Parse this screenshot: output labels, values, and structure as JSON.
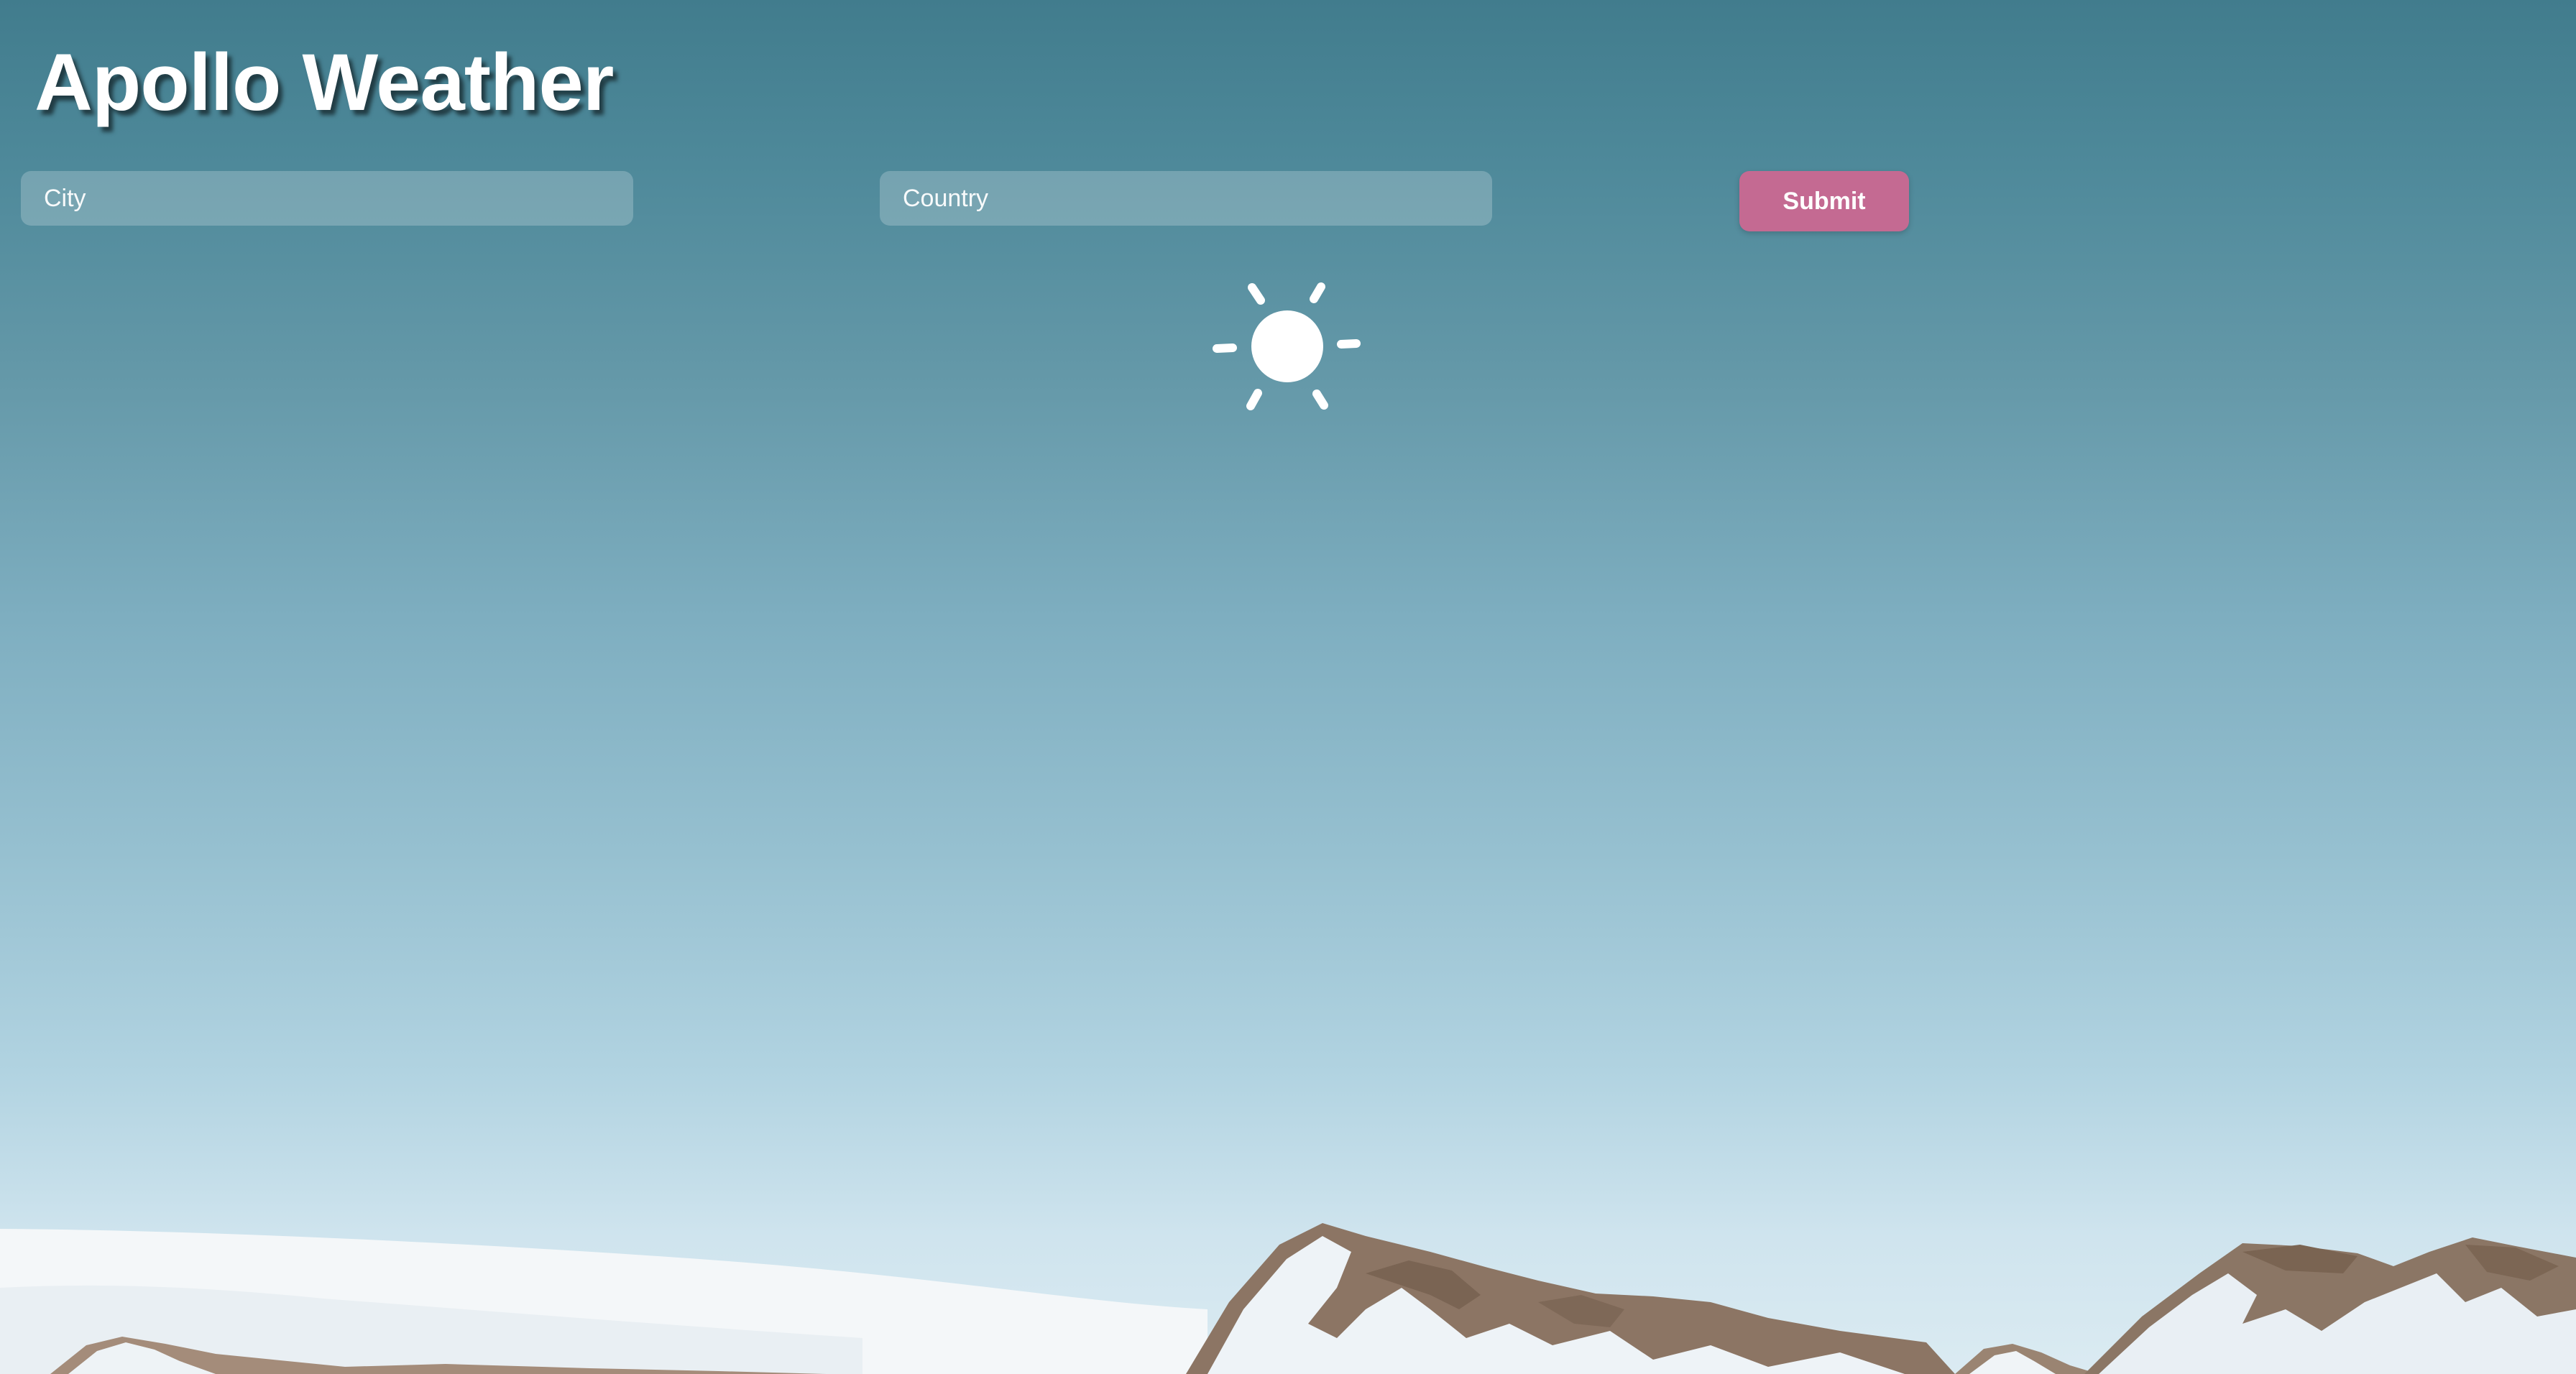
{
  "header": {
    "title": "Apollo Weather"
  },
  "form": {
    "city_placeholder": "City",
    "country_placeholder": "Country",
    "submit_label": "Submit"
  },
  "weather": {
    "icon": "sun-icon"
  },
  "colors": {
    "accent_button": "#c46a92",
    "sky_top": "#417c8d",
    "sky_bottom": "#dbebf2"
  }
}
